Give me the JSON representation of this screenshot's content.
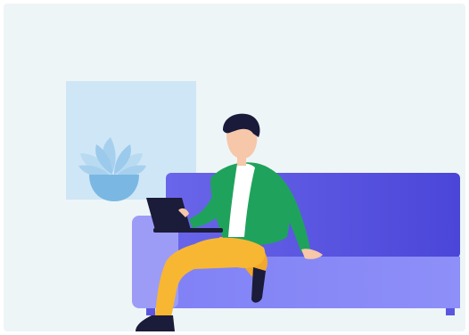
{
  "illustration": {
    "subject": "person-with-laptop-on-sofa",
    "colors": {
      "background": "#eef5f7",
      "window": "#cfe6f6",
      "plant_leaves": "#a7d0ee",
      "plant_pot": "#7ab8e3",
      "sofa_back": "#5b56e0",
      "sofa_seat": "#8586f6",
      "sofa_arm": "#9c9cf7",
      "jacket": "#1fa35c",
      "shirt": "#ffffff",
      "pants": "#f7b733",
      "skin": "#f6c7a9",
      "hair": "#1a1a3a",
      "shoes": "#1b1b3a",
      "laptop": "#1b1b3a"
    }
  }
}
